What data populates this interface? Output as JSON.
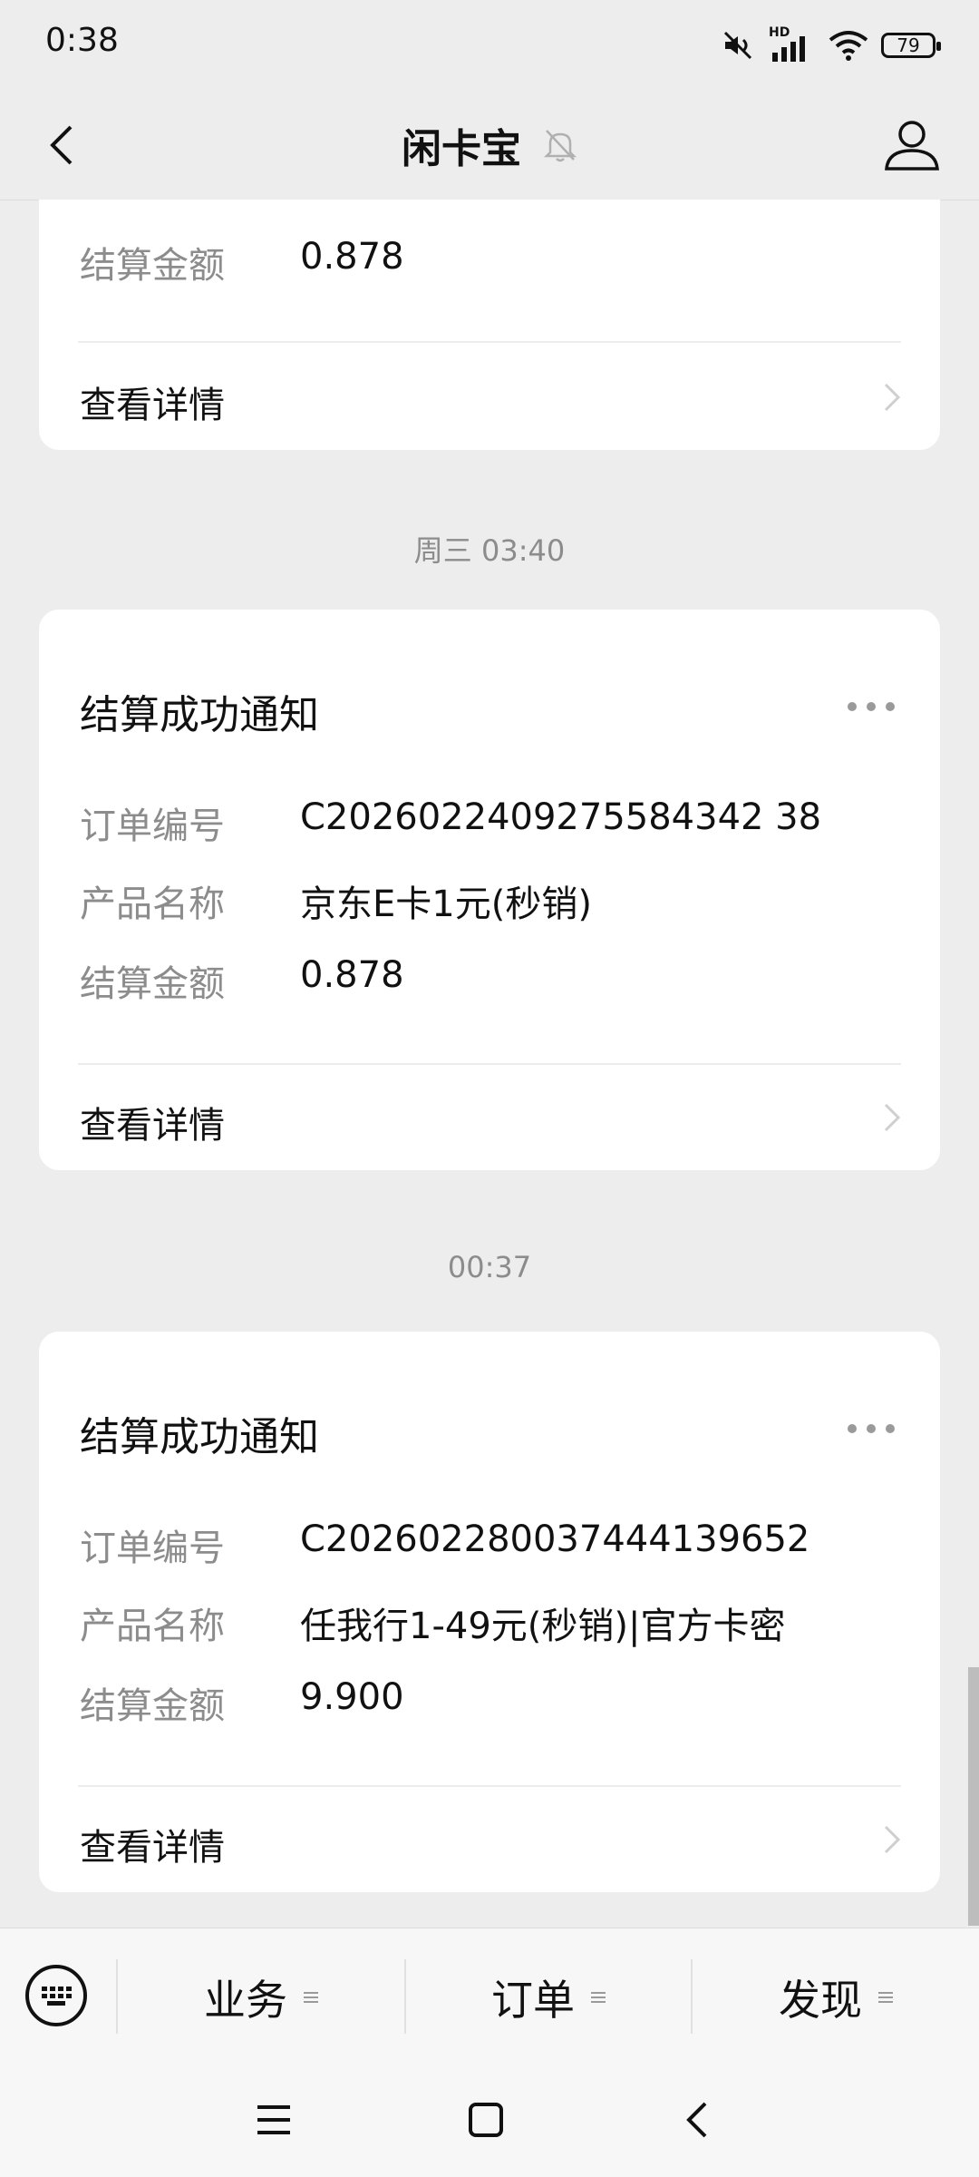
{
  "status_bar": {
    "time": "0:38",
    "icons": [
      "mute-icon",
      "hd-signal-icon",
      "wifi-icon",
      "battery-icon"
    ],
    "network_badge": "HD",
    "battery_level": "79"
  },
  "nav": {
    "title": "闲卡宝",
    "icons": [
      "back-icon",
      "mute-bell-icon",
      "profile-icon"
    ]
  },
  "messages": [
    {
      "timestamp": "",
      "partial": true,
      "fields": [
        {
          "label": "结算金额",
          "value": "0.878"
        }
      ],
      "detail_label": "查看详情"
    },
    {
      "timestamp": "周三 03:40",
      "title": "结算成功通知",
      "fields": [
        {
          "label": "订单编号",
          "value": "C2026022409275584342 38"
        },
        {
          "label": "产品名称",
          "value": "京东E卡1元(秒销)"
        },
        {
          "label": "结算金额",
          "value": "0.878"
        }
      ],
      "detail_label": "查看详情"
    },
    {
      "timestamp": "00:37",
      "title": "结算成功通知",
      "fields": [
        {
          "label": "订单编号",
          "value": "C202602280037444139652"
        },
        {
          "label": "产品名称",
          "value": "任我行1-49元(秒销)|官方卡密"
        },
        {
          "label": "结算金额",
          "value": "9.900"
        }
      ],
      "detail_label": "查看详情"
    }
  ],
  "menu_bar": {
    "items": [
      "业务",
      "订单",
      "发现"
    ]
  },
  "colors": {
    "background": "#ededed",
    "card": "#ffffff",
    "label_gray": "#8c8c8c",
    "text": "#111111"
  }
}
